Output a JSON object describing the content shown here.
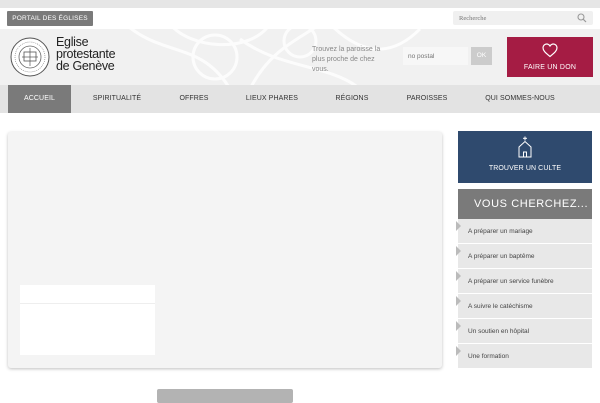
{
  "topbar": {
    "portal_label": "PORTAIL DES ÉGLISES",
    "search_placeholder": "Recherche",
    "search_icon": "magnifier-icon"
  },
  "logo": {
    "line1": "Eglise",
    "line2": "protestante",
    "line3": "de Genève",
    "seal_icon": "church-seal-icon"
  },
  "finder": {
    "text": "Trouvez la paroisse la plus proche de chez vous.",
    "postal_placeholder": "no postal",
    "ok_label": "OK"
  },
  "donation": {
    "label": "FAIRE UN DON",
    "icon": "heart-icon",
    "color": "#a51c44"
  },
  "nav": {
    "items": [
      {
        "label": "ACCUEIL",
        "active": true
      },
      {
        "label": "SPIRITUALITÉ",
        "active": false
      },
      {
        "label": "OFFRES",
        "active": false
      },
      {
        "label": "LIEUX PHARES",
        "active": false
      },
      {
        "label": "RÉGIONS",
        "active": false
      },
      {
        "label": "PAROISSES",
        "active": false
      },
      {
        "label": "QUI SOMMES-NOUS",
        "active": false
      }
    ]
  },
  "sidebar": {
    "culte_label": "TROUVER UN CULTE",
    "culte_icon": "church-icon",
    "culte_color": "#2f4a6e",
    "vous_title": "VOUS CHERCHEZ...",
    "items": [
      {
        "label": "A préparer un mariage"
      },
      {
        "label": "A préparer un baptême"
      },
      {
        "label": "A préparer un service funèbre"
      },
      {
        "label": "A suivre le catéchisme"
      },
      {
        "label": "Un soutien en hôpital"
      },
      {
        "label": "Une formation"
      }
    ]
  }
}
